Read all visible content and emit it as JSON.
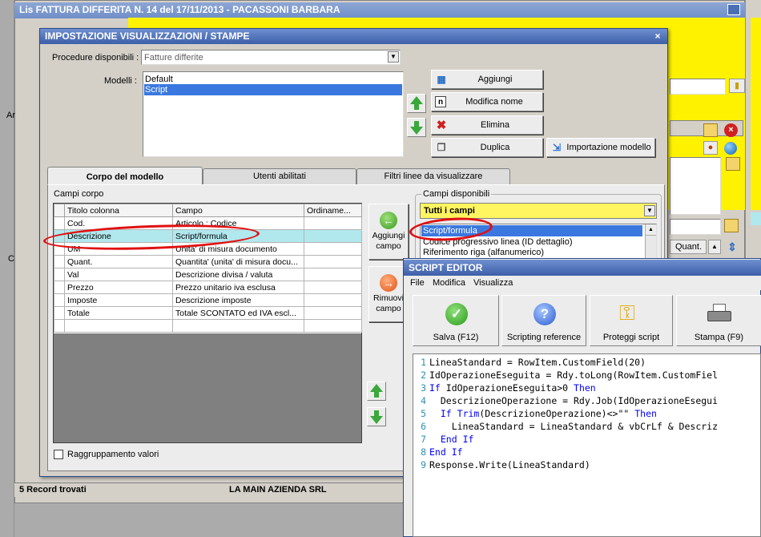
{
  "bg_window": {
    "title": "Lis FATTURA DIFFERITA N. 14 del 17/11/2013 - PACASSONI BARBARA",
    "left_label_1": "Ar",
    "left_label_2": "C",
    "status_count": "5 Record trovati",
    "status_right": "LA MAIN AZIENDA SRL",
    "quant_label": "Quant."
  },
  "dialog": {
    "title": "IMPOSTAZIONE VISUALIZZAZIONI / STAMPE",
    "close_glyph": "×",
    "procedure_label": "Procedure disponibili :",
    "procedure_value": "Fatture differite",
    "modelli_label": "Modelli :",
    "modelli": [
      "Default",
      "Script"
    ],
    "buttons": {
      "aggiungi": "Aggiungi",
      "modifica_nome": "Modifica nome",
      "elimina": "Elimina",
      "duplica": "Duplica",
      "importazione": "Importazione modello"
    },
    "tabs": [
      "Corpo del modello",
      "Utenti abilitati",
      "Filtri linee da visualizzare"
    ],
    "campi_corpo_label": "Campi corpo",
    "grid_headers": [
      "Titolo colonna",
      "Campo",
      "Ordiname..."
    ],
    "grid_rows": [
      [
        "Cod.",
        "Articolo : Codice",
        ""
      ],
      [
        "Descrizione",
        "Script/formula",
        ""
      ],
      [
        "UM",
        "Unita' di misura documento",
        ""
      ],
      [
        "Quant.",
        "Quantita' (unita' di misura docu...",
        ""
      ],
      [
        "Val",
        "Descrizione divisa / valuta",
        ""
      ],
      [
        "Prezzo",
        "Prezzo unitario iva esclusa",
        ""
      ],
      [
        "Imposte",
        "Descrizione imposte",
        ""
      ],
      [
        "Totale",
        "Totale SCONTATO ed IVA escl...",
        ""
      ]
    ],
    "aggiungi_campo": "Aggiungi campo",
    "rimuovi_campo": "Rimuovi campo",
    "raggruppamento": "Raggruppamento valori",
    "campi_disponibili_label": "Campi disponibili",
    "campi_filter": "Tutti i campi",
    "campi_list": [
      "Script/formula",
      "Codice progressivo linea (ID dettaglio)",
      "Riferimento riga (alfanumerico)"
    ]
  },
  "script_editor": {
    "title": "SCRIPT EDITOR",
    "menu": [
      "File",
      "Modifica",
      "Visualizza"
    ],
    "toolbar": [
      "Salva (F12)",
      "Scripting reference",
      "Proteggi script",
      "Stampa (F9)"
    ],
    "code": [
      "LineaStandard = RowItem.CustomField(20)",
      "IdOperazioneEseguita = Rdy.toLong(RowItem.CustomFiel",
      "If IdOperazioneEseguita>0 Then",
      "  DescrizioneOperazione = Rdy.Job(IdOperazioneEsegui",
      "  If Trim(DescrizioneOperazione)<>\"\" Then",
      "    LineaStandard = LineaStandard & vbCrLf & Descriz",
      "  End If",
      "End If",
      "Response.Write(LineaStandard)"
    ]
  },
  "colors": {
    "titlebar_blue": "#4a6fb5",
    "yellow": "#fff200",
    "selection": "#b0e8ee",
    "highlight_ellipse": "#e01010"
  }
}
